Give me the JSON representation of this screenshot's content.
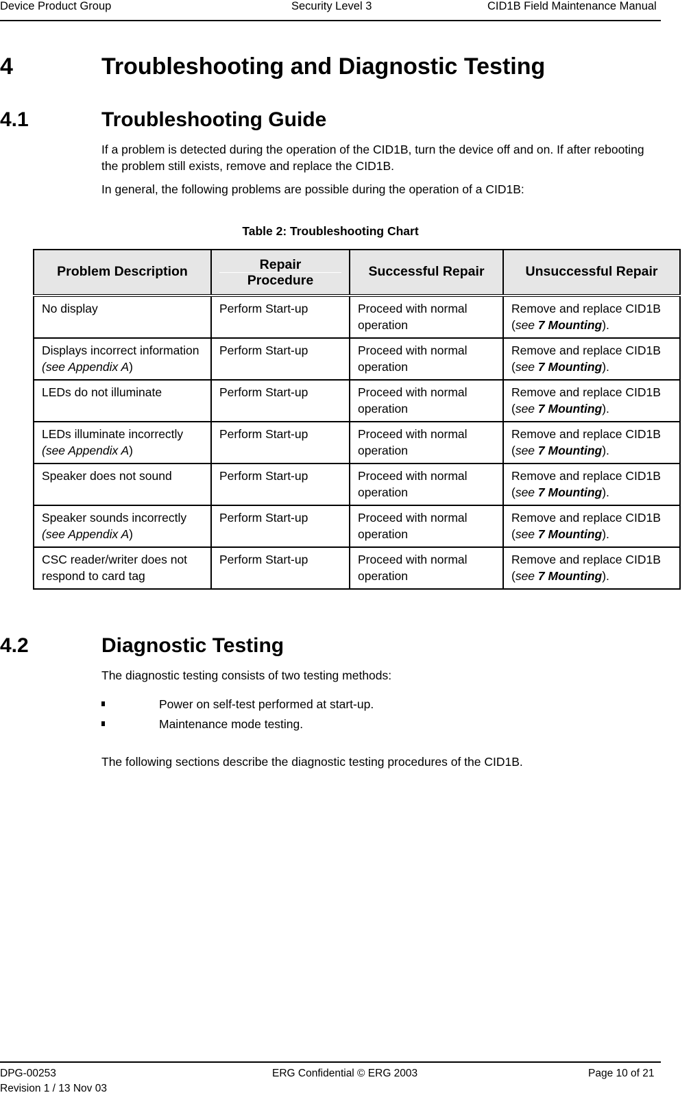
{
  "header": {
    "left": "Device Product Group",
    "center": "Security Level 3",
    "right": "CID1B Field Maintenance Manual"
  },
  "chapter": {
    "number": "4",
    "title": "Troubleshooting and Diagnostic Testing"
  },
  "section_41": {
    "number": "4.1",
    "title": "Troubleshooting Guide",
    "paragraph1": "If a problem is detected during the operation of the CID1B, turn the device off and on. If after rebooting the problem still exists, remove and replace the CID1B.",
    "paragraph2": "In general, the following problems are possible during the operation of a CID1B:"
  },
  "table": {
    "caption": "Table 2: Troubleshooting Chart",
    "headers": {
      "problem": "Problem Description",
      "procedure_line1": "Repair",
      "procedure_line2": "Procedure",
      "success": "Successful Repair",
      "fail": "Unsuccessful Repair"
    },
    "rows": [
      {
        "problem": "No display",
        "problem_note": "",
        "procedure": "Perform Start-up",
        "success": "Proceed with normal operation",
        "fail_prefix": "Remove and replace CID1B (",
        "fail_see": "see ",
        "fail_ref": "7 Mounting",
        "fail_suffix": ")."
      },
      {
        "problem": "Displays incorrect information",
        "problem_note": "(see Appendix A)",
        "procedure": "Perform Start-up",
        "success": "Proceed with normal operation",
        "fail_prefix": "Remove and replace CID1B (",
        "fail_see": "see ",
        "fail_ref": "7 Mounting",
        "fail_suffix": ")."
      },
      {
        "problem": "LEDs do not illuminate",
        "problem_note": "",
        "procedure": "Perform Start-up",
        "success": "Proceed with normal operation",
        "fail_prefix": "Remove and replace CID1B (",
        "fail_see": "see ",
        "fail_ref": "7 Mounting",
        "fail_suffix": ")."
      },
      {
        "problem": "LEDs illuminate incorrectly",
        "problem_note": "(see Appendix A)",
        "procedure": "Perform Start-up",
        "success": "Proceed with normal operation",
        "fail_prefix": "Remove and replace CID1B (",
        "fail_see": "see ",
        "fail_ref": "7 Mounting",
        "fail_suffix": ")."
      },
      {
        "problem": "Speaker does not sound",
        "problem_note": "",
        "procedure": "Perform Start-up",
        "success": "Proceed with normal operation",
        "fail_prefix": "Remove and replace CID1B (",
        "fail_see": "see ",
        "fail_ref": "7 Mounting",
        "fail_suffix": ")."
      },
      {
        "problem": "Speaker sounds incorrectly",
        "problem_note": "(see Appendix A)",
        "procedure": "Perform Start-up",
        "success": "Proceed with normal operation",
        "fail_prefix": "Remove and replace CID1B (",
        "fail_see": "see ",
        "fail_ref": "7 Mounting",
        "fail_suffix": ")."
      },
      {
        "problem": "CSC reader/writer does not respond to card tag",
        "problem_note": "",
        "procedure": "Perform Start-up",
        "success": "Proceed with normal operation",
        "fail_prefix": "Remove and replace CID1B (",
        "fail_see": "see ",
        "fail_ref": "7 Mounting",
        "fail_suffix": ")."
      }
    ]
  },
  "section_42": {
    "number": "4.2",
    "title": "Diagnostic Testing",
    "intro": "The diagnostic testing consists of two testing methods:",
    "bullets": [
      "Power on self-test performed at start-up.",
      "Maintenance mode testing."
    ],
    "closing": "The following sections describe the diagnostic testing procedures of the CID1B."
  },
  "footer": {
    "doc_id": "DPG-00253",
    "revision": "Revision 1 / 13 Nov 03",
    "confidential": "ERG Confidential © ERG 2003",
    "page": "Page 10 of 21"
  }
}
